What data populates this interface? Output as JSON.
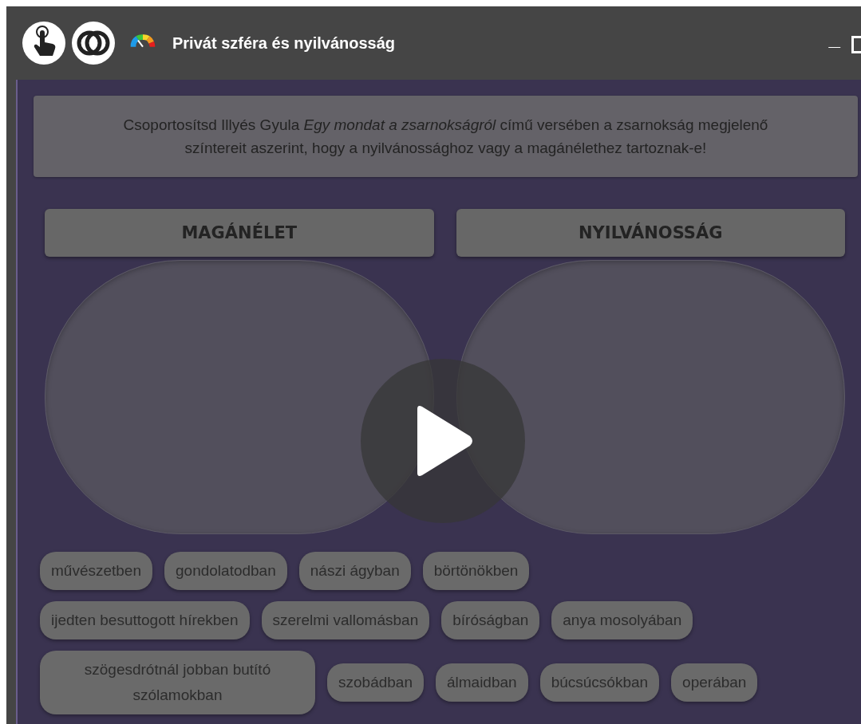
{
  "window": {
    "title": "Privát szféra és nyilvánosság",
    "controls": [
      "_"
    ]
  },
  "instruction": "Csoportosítsd Illyés Gyula *Egy mondat a zsarnokságról* című versében a zsarnokság megjelenő színtereit aszerint, hogy a nyilvánossághoz vagy a magánélethez tartoznak-e!",
  "groups": [
    {
      "label": "MAGÁNÉLET"
    },
    {
      "label": "NYILVÁNOSSÁG"
    }
  ],
  "chip_rows": [
    [
      "művészetben",
      "gondolatodban",
      "nászi ágyban",
      "börtönökben"
    ],
    [
      "ijedten besuttogott hírekben",
      "szerelmi vallomásban",
      "bíróságban",
      "anya mosolyában"
    ],
    [
      "szögesdrótnál jobban butító szólamokban",
      "szobádban",
      "álmaidban",
      "búcsúcsókban",
      "operában"
    ]
  ]
}
